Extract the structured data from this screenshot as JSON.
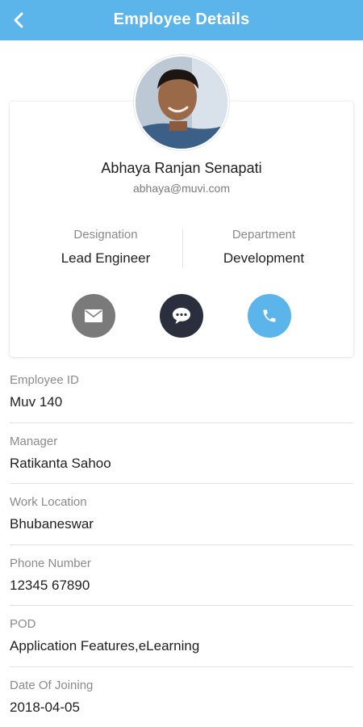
{
  "header": {
    "title": "Employee Details",
    "background": "#5bb4ea",
    "back_icon": "chevron-left-icon"
  },
  "profile": {
    "name": "Abhaya Ranjan Senapati",
    "email": "abhaya@muvi.com",
    "designation_label": "Designation",
    "designation_value": "Lead Engineer",
    "department_label": "Department",
    "department_value": "Development"
  },
  "actions": [
    {
      "icon": "mail-icon",
      "color": "#7a7a7a"
    },
    {
      "icon": "chat-icon",
      "color": "#2b2f3d"
    },
    {
      "icon": "phone-icon",
      "color": "#5bb4ea"
    }
  ],
  "details": [
    {
      "label": "Employee ID",
      "value": "Muv 140"
    },
    {
      "label": "Manager",
      "value": "Ratikanta Sahoo"
    },
    {
      "label": "Work Location",
      "value": "Bhubaneswar"
    },
    {
      "label": "Phone Number",
      "value": "12345 67890"
    },
    {
      "label": "POD",
      "value": "Application Features,eLearning"
    },
    {
      "label": "Date Of Joining",
      "value": "2018-04-05"
    }
  ]
}
